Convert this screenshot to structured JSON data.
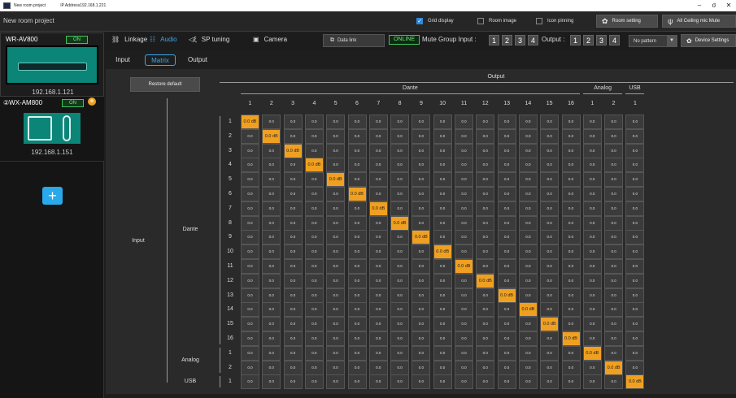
{
  "titlebar": {
    "app_title": "New room project",
    "ip_address": "IP Address192.168.1.221",
    "min": "–",
    "max": "σ",
    "close": "✕"
  },
  "projbar": {
    "project_name": "New room project",
    "grid_display": {
      "label": "Grid display",
      "checked": true
    },
    "room_image": {
      "label": "Room image",
      "checked": false
    },
    "icon_pinning": {
      "label": "Icon pinning",
      "checked": false
    },
    "room_setting": "Room setting",
    "ceiling_mute": "All Ceiling mic Mute"
  },
  "sidebar": {
    "devices": [
      {
        "name": "WR-AV800",
        "status": "ON",
        "ip": "192.168.1.121"
      },
      {
        "name": "②WX-AM800",
        "status": "ON",
        "ip": "192.168.1.151",
        "warn": "⊗"
      }
    ],
    "add_label": "+"
  },
  "tabs": {
    "linkage": "Linkage",
    "audio": "Audio",
    "sp_tuning": "SP tuning",
    "camera": "Camera"
  },
  "toolbar": {
    "data_link": "Data link",
    "online": "ONLINE",
    "mute_group_input": "Mute Group Input :",
    "input_groups": [
      "1",
      "2",
      "3",
      "4"
    ],
    "output_label": "Output :",
    "output_groups": [
      "1",
      "2",
      "3",
      "4"
    ],
    "pattern": "No pattern",
    "device_settings": "Device Settings"
  },
  "subtabs": {
    "input": "Input",
    "matrix": "Matrix",
    "output": "Output",
    "active": "Matrix"
  },
  "matrix": {
    "restore_default": "Restore default",
    "output_title": "Output",
    "input_title": "Input",
    "out_groups": [
      {
        "name": "Dante",
        "cols": 16
      },
      {
        "name": "Analog",
        "cols": 2
      },
      {
        "name": "USB",
        "cols": 1
      }
    ],
    "out_cols": [
      "1",
      "2",
      "3",
      "4",
      "5",
      "6",
      "7",
      "8",
      "9",
      "10",
      "11",
      "12",
      "13",
      "14",
      "15",
      "16",
      "1",
      "2",
      "1"
    ],
    "in_groups": [
      {
        "name": "Dante",
        "rows": 16
      },
      {
        "name": "Analog",
        "rows": 2
      },
      {
        "name": "USB",
        "rows": 1
      }
    ],
    "in_rows": [
      "1",
      "2",
      "3",
      "4",
      "5",
      "6",
      "7",
      "8",
      "9",
      "10",
      "11",
      "12",
      "13",
      "14",
      "15",
      "16",
      "1",
      "2",
      "1"
    ],
    "default_value": "0.0",
    "active_value": "0.0 dB",
    "active_color": "#f0a020"
  }
}
